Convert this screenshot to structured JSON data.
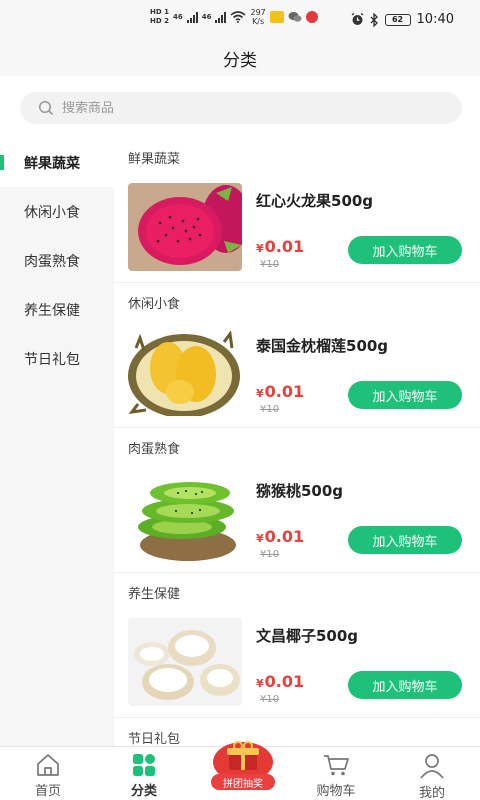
{
  "status_bar": {
    "net_speed_value": "297",
    "net_speed_unit": "K/s",
    "battery": "62",
    "time": "10:40",
    "hd1": "HD 1",
    "hd2": "HD 2",
    "sig1": "46",
    "sig2": "46"
  },
  "header": {
    "title": "分类"
  },
  "search": {
    "placeholder": "搜索商品"
  },
  "sidebar": {
    "items": [
      {
        "label": "鲜果蔬菜",
        "active": true
      },
      {
        "label": "休闲小食"
      },
      {
        "label": "肉蛋熟食"
      },
      {
        "label": "养生保健"
      },
      {
        "label": "节日礼包"
      }
    ]
  },
  "sections": [
    {
      "title": "鲜果蔬菜",
      "product": {
        "name": "红心火龙果500g",
        "currency": "¥",
        "price": "0.01",
        "original": "¥10",
        "button": "加入购物车",
        "image": "dragon-fruit"
      }
    },
    {
      "title": "休闲小食",
      "product": {
        "name": "泰国金枕榴莲500g",
        "currency": "¥",
        "price": "0.01",
        "original": "¥10",
        "button": "加入购物车",
        "image": "durian"
      }
    },
    {
      "title": "肉蛋熟食",
      "product": {
        "name": "猕猴桃500g",
        "currency": "¥",
        "price": "0.01",
        "original": "¥10",
        "button": "加入购物车",
        "image": "kiwi"
      }
    },
    {
      "title": "养生保健",
      "product": {
        "name": "文昌椰子500g",
        "currency": "¥",
        "price": "0.01",
        "original": "¥10",
        "button": "加入购物车",
        "image": "coconut"
      }
    },
    {
      "title": "节日礼包"
    }
  ],
  "tabbar": {
    "home": "首页",
    "category": "分类",
    "promo": "拼团抽奖",
    "cart": "购物车",
    "mine": "我的"
  },
  "colors": {
    "accent": "#1fc17a",
    "price": "#e8413c",
    "promo": "#e94040"
  }
}
